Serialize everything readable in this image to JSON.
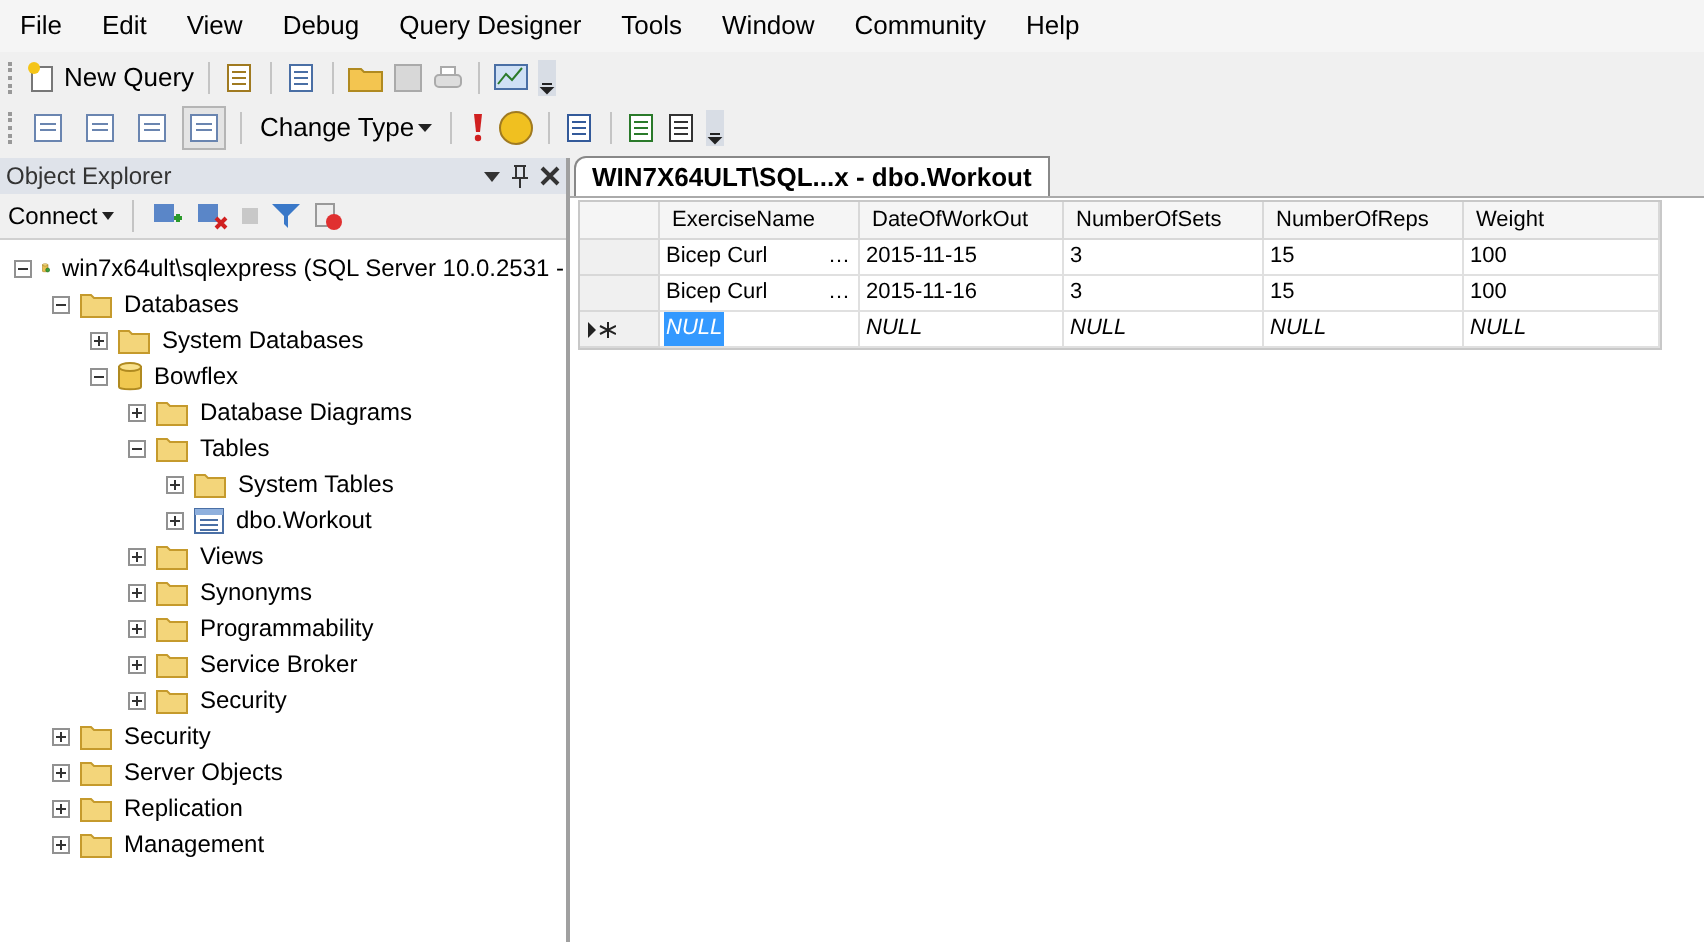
{
  "menu": [
    "File",
    "Edit",
    "View",
    "Debug",
    "Query Designer",
    "Tools",
    "Window",
    "Community",
    "Help"
  ],
  "toolbar_1": {
    "new_query": "New Query"
  },
  "toolbar_2": {
    "change_type": "Change Type",
    "pane_toggles": [
      {
        "selected": false
      },
      {
        "selected": false
      },
      {
        "selected": false
      },
      {
        "selected": true
      }
    ]
  },
  "object_explorer": {
    "title": "Object Explorer",
    "connect": "Connect",
    "tree": [
      {
        "label": "win7x64ult\\sqlexpress (SQL Server 10.0.2531 -",
        "kind": "server",
        "expanded": true,
        "children": [
          {
            "label": "Databases",
            "kind": "folder",
            "expanded": true,
            "children": [
              {
                "label": "System Databases",
                "kind": "folder",
                "expanded": false
              },
              {
                "label": "Bowflex",
                "kind": "database",
                "expanded": true,
                "children": [
                  {
                    "label": "Database Diagrams",
                    "kind": "folder",
                    "expanded": false
                  },
                  {
                    "label": "Tables",
                    "kind": "folder",
                    "expanded": true,
                    "children": [
                      {
                        "label": "System Tables",
                        "kind": "folder",
                        "expanded": false
                      },
                      {
                        "label": "dbo.Workout",
                        "kind": "table",
                        "expanded": false
                      }
                    ]
                  },
                  {
                    "label": "Views",
                    "kind": "folder",
                    "expanded": false
                  },
                  {
                    "label": "Synonyms",
                    "kind": "folder",
                    "expanded": false
                  },
                  {
                    "label": "Programmability",
                    "kind": "folder",
                    "expanded": false
                  },
                  {
                    "label": "Service Broker",
                    "kind": "folder",
                    "expanded": false
                  },
                  {
                    "label": "Security",
                    "kind": "folder",
                    "expanded": false
                  }
                ]
              }
            ]
          },
          {
            "label": "Security",
            "kind": "folder",
            "expanded": false
          },
          {
            "label": "Server Objects",
            "kind": "folder",
            "expanded": false
          },
          {
            "label": "Replication",
            "kind": "folder",
            "expanded": false
          },
          {
            "label": "Management",
            "kind": "folder",
            "expanded": false
          }
        ]
      }
    ]
  },
  "document_tab": {
    "title": "WIN7X64ULT\\SQL...x - dbo.Workout"
  },
  "table": {
    "columns": [
      "ExerciseName",
      "DateOfWorkOut",
      "NumberOfSets",
      "NumberOfReps",
      "Weight"
    ],
    "rows": [
      {
        "new_row": false,
        "cells": [
          {
            "text": "Bicep Curl",
            "more": "…",
            "selected": false
          },
          {
            "text": "2015-11-15",
            "selected": false
          },
          {
            "text": "3",
            "selected": false
          },
          {
            "text": "15",
            "selected": false
          },
          {
            "text": "100",
            "selected": false
          }
        ]
      },
      {
        "new_row": false,
        "cells": [
          {
            "text": "Bicep Curl",
            "more": "…",
            "selected": false
          },
          {
            "text": "2015-11-16",
            "selected": false
          },
          {
            "text": "3",
            "selected": false
          },
          {
            "text": "15",
            "selected": false
          },
          {
            "text": "100",
            "selected": false
          }
        ]
      },
      {
        "new_row": true,
        "cells": [
          {
            "text": "NULL",
            "selected": true
          },
          {
            "text": "NULL",
            "selected": false
          },
          {
            "text": "NULL",
            "selected": false
          },
          {
            "text": "NULL",
            "selected": false
          },
          {
            "text": "NULL",
            "selected": false
          }
        ]
      }
    ]
  }
}
